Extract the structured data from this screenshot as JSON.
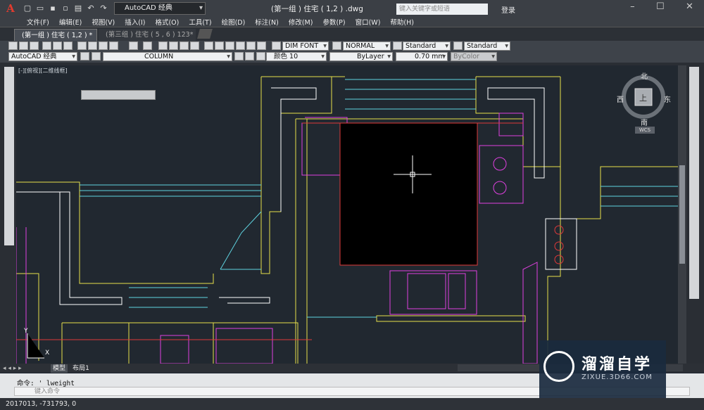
{
  "app": {
    "logo": "A",
    "workspace": "AutoCAD 经典",
    "doc_title": "(第一组 ) 住宅 ( 1,2 ) .dwg",
    "search_placeholder": "键入关键字或短语",
    "login": "登录"
  },
  "menu": [
    "文件(F)",
    "编辑(E)",
    "视图(V)",
    "插入(I)",
    "格式(O)",
    "工具(T)",
    "绘图(D)",
    "标注(N)",
    "修改(M)",
    "参数(P)",
    "窗口(W)",
    "帮助(H)"
  ],
  "tabs": [
    {
      "label": "(第一组 ) 住宅 ( 1,2 ) *"
    },
    {
      "label": "(第三组 ) 住宅 ( 5 , 6 ) 123*"
    }
  ],
  "styles": {
    "text": "DIM FONT",
    "dim": "NORMAL",
    "table": "Standard",
    "mleader": "Standard"
  },
  "layer": {
    "workspace": "AutoCAD 经典",
    "current": "COLUMN"
  },
  "properties": {
    "color": "颜色 10",
    "linetype": "ByLayer",
    "lineweight": "0.70 mm",
    "plotstyle": "ByColor"
  },
  "viewport": {
    "label": "[-][俯视][二维线框]"
  },
  "compass": {
    "n": "北",
    "s": "南",
    "e": "东",
    "w": "西",
    "top": "上",
    "wcs": "WCS"
  },
  "layout_tabs": [
    "模型",
    "布局1"
  ],
  "command": {
    "history": "命令: '_lweight",
    "placeholder": "键入命令"
  },
  "status": {
    "coords": "2017013, -731793, 0"
  },
  "watermark": {
    "title": "溜溜自学",
    "sub": "ZIXUE.3D66.COM"
  },
  "ucs": {
    "x": "X",
    "y": "Y"
  }
}
